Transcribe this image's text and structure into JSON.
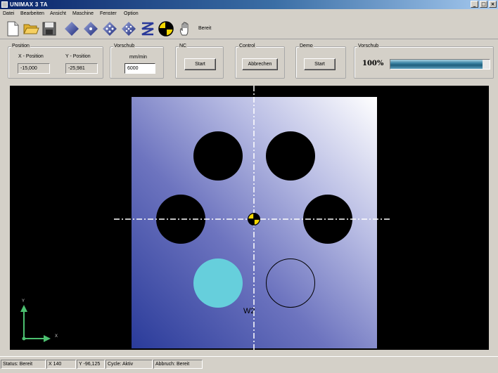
{
  "window": {
    "title": "UNIMAX 3 TA"
  },
  "menu": [
    "Datei",
    "Bearbeiten",
    "Ansicht",
    "Maschine",
    "Fenster",
    "Option"
  ],
  "toolbar": {
    "status_text": "Bereit",
    "icons": [
      "new-file-icon",
      "open-folder-icon",
      "save-disk-icon",
      "diamond-solid-icon",
      "diamond-dot-icon",
      "diamond-cross-icon",
      "diamond-pattern-icon",
      "zigzag-tool-icon",
      "crosshair-target-icon",
      "hand-icon"
    ]
  },
  "position": {
    "group_label": "Position",
    "x_label": "X - Position",
    "y_label": "Y - Position",
    "x_value": "-15,000",
    "y_value": "-25,981"
  },
  "feed": {
    "group_label": "Vorschub",
    "unit_label": "mm/min",
    "value": "6000"
  },
  "nc": {
    "group_label": "NC",
    "button": "Start"
  },
  "control": {
    "group_label": "Control",
    "button": "Abbrechen"
  },
  "demo": {
    "group_label": "Demo",
    "button": "Start"
  },
  "feed_rate": {
    "group_label": "Vorschub",
    "percent_text": "100%",
    "level": 0.93
  },
  "canvas": {
    "workpiece_label": "W2",
    "axis_y": "Y",
    "axis_x": "X",
    "colors": {
      "background": "#000000",
      "active_hole": "#66cfdc",
      "crosshair": "#ffffff",
      "marker": "#f5d800"
    }
  },
  "statusbar": {
    "status": "Status: Bereit",
    "x": "X 140",
    "y": "Y -96,125",
    "cycle": "Cycle: Aktiv",
    "abort": "Abbruch: Bereit"
  }
}
